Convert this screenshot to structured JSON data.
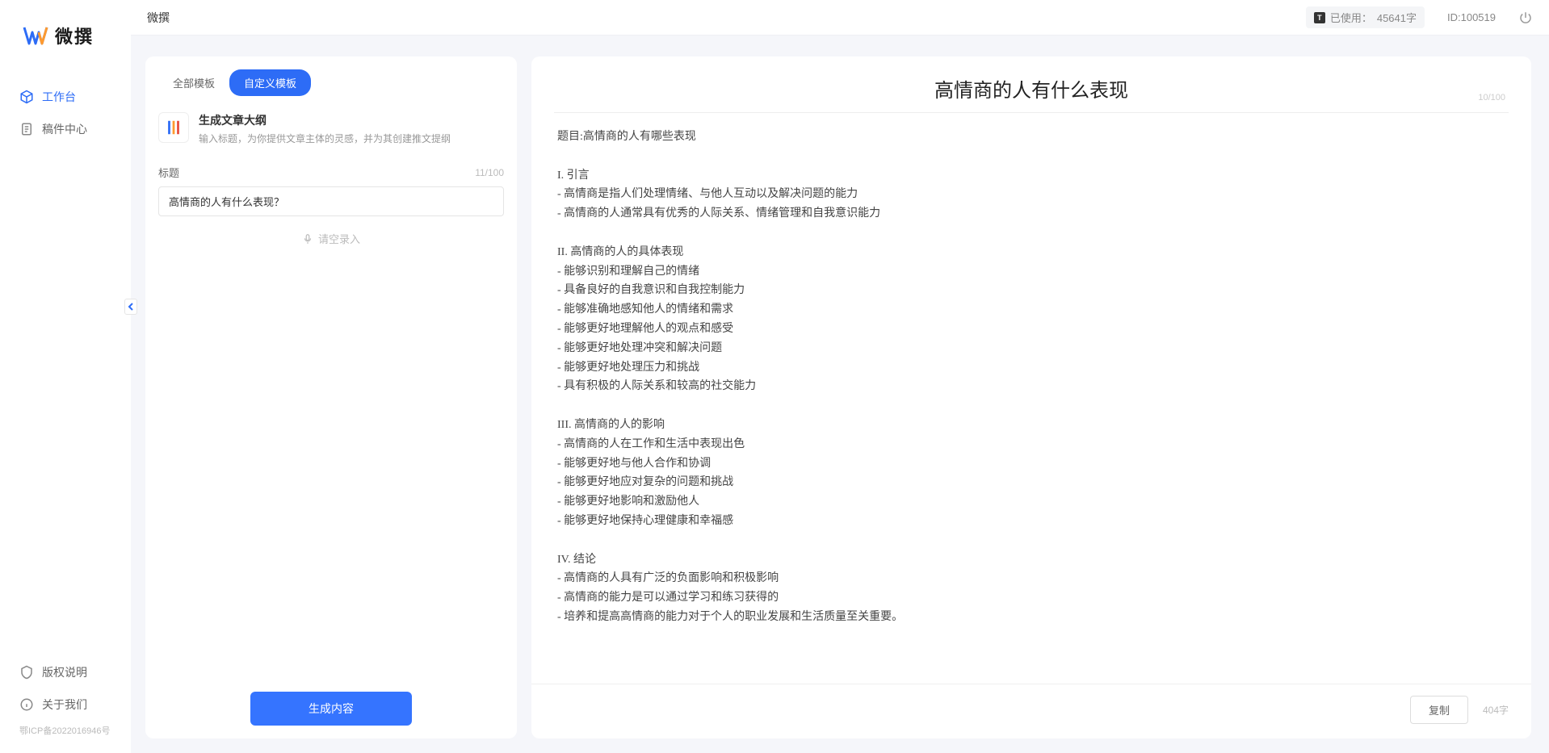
{
  "app": {
    "name": "微撰",
    "usage_label": "已使用：",
    "usage_value": "45641字",
    "user_id_label": "ID:100519",
    "icp": "鄂ICP备2022016946号"
  },
  "sidebar": {
    "items": [
      {
        "label": "工作台",
        "active": true
      },
      {
        "label": "稿件中心",
        "active": false
      }
    ],
    "bottom": [
      {
        "label": "版权说明"
      },
      {
        "label": "关于我们"
      }
    ]
  },
  "tabs": {
    "all": "全部模板",
    "custom": "自定义模板"
  },
  "tool": {
    "title": "生成文章大纲",
    "desc": "输入标题，为你提供文章主体的灵感，并为其创建推文提纲"
  },
  "form": {
    "title_label": "标题",
    "title_count": "11/100",
    "title_value": "高情商的人有什么表现？",
    "voice_label": "请空录入"
  },
  "actions": {
    "generate": "生成内容",
    "copy": "复制"
  },
  "result": {
    "title": "高情商的人有什么表现",
    "title_count": "10/100",
    "char_count": "404字",
    "body": "题目:高情商的人有哪些表现\n\nI. 引言\n- 高情商是指人们处理情绪、与他人互动以及解决问题的能力\n- 高情商的人通常具有优秀的人际关系、情绪管理和自我意识能力\n\nII. 高情商的人的具体表现\n- 能够识别和理解自己的情绪\n- 具备良好的自我意识和自我控制能力\n- 能够准确地感知他人的情绪和需求\n- 能够更好地理解他人的观点和感受\n- 能够更好地处理冲突和解决问题\n- 能够更好地处理压力和挑战\n- 具有积极的人际关系和较高的社交能力\n\nIII. 高情商的人的影响\n- 高情商的人在工作和生活中表现出色\n- 能够更好地与他人合作和协调\n- 能够更好地应对复杂的问题和挑战\n- 能够更好地影响和激励他人\n- 能够更好地保持心理健康和幸福感\n\nIV. 结论\n- 高情商的人具有广泛的负面影响和积极影响\n- 高情商的能力是可以通过学习和练习获得的\n- 培养和提高高情商的能力对于个人的职业发展和生活质量至关重要。"
  }
}
